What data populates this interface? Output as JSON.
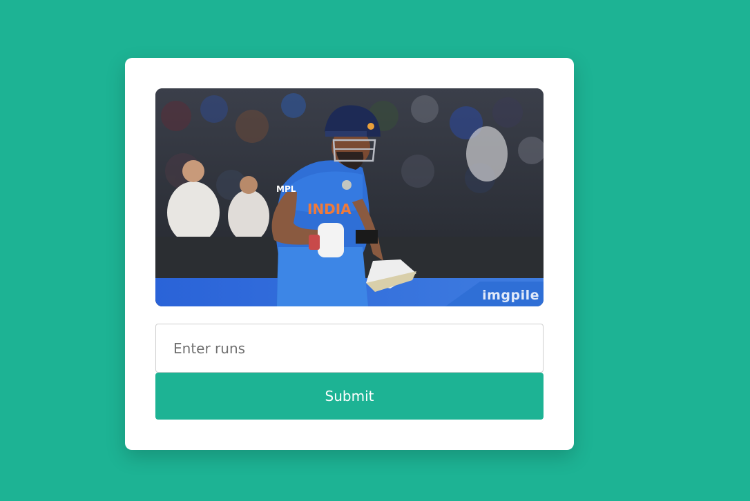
{
  "form": {
    "input_placeholder": "Enter runs",
    "input_value": "",
    "submit_label": "Submit"
  },
  "photo": {
    "jersey_text": "INDIA",
    "sponsor_text": "MPL",
    "watermark": "imgpile"
  },
  "colors": {
    "background": "#1db394",
    "card": "#ffffff",
    "button": "#1db394",
    "jersey": "#2f6fd6"
  }
}
